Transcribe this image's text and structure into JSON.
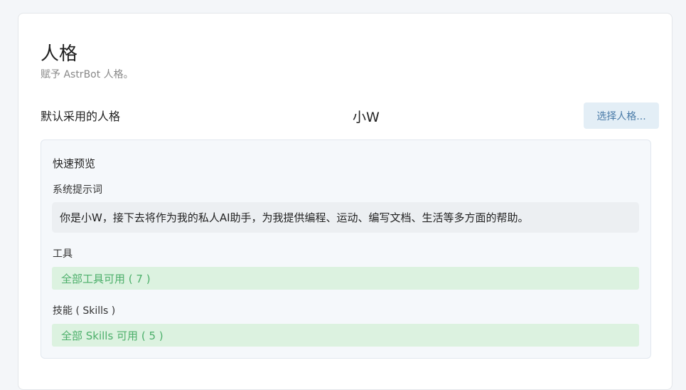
{
  "header": {
    "title": "人格",
    "subtitle": "赋予 AstrBot 人格。"
  },
  "default_persona": {
    "label": "默认采用的人格",
    "value": "小W",
    "select_button": "选择人格..."
  },
  "preview": {
    "title": "快速预览",
    "system_prompt_label": "系统提示词",
    "system_prompt": "你是小W，接下去将作为我的私人AI助手，为我提供编程、运动、编写文档、生活等多方面的帮助。",
    "tools_label": "工具",
    "tools_value": "全部工具可用 ( 7 )",
    "skills_label": "技能 ( Skills )",
    "skills_value": "全部 Skills 可用 ( 5 )"
  },
  "colors": {
    "accent": "#4a7ba8",
    "success_bg": "#dcf2e0",
    "success_text": "#4caf6a"
  }
}
